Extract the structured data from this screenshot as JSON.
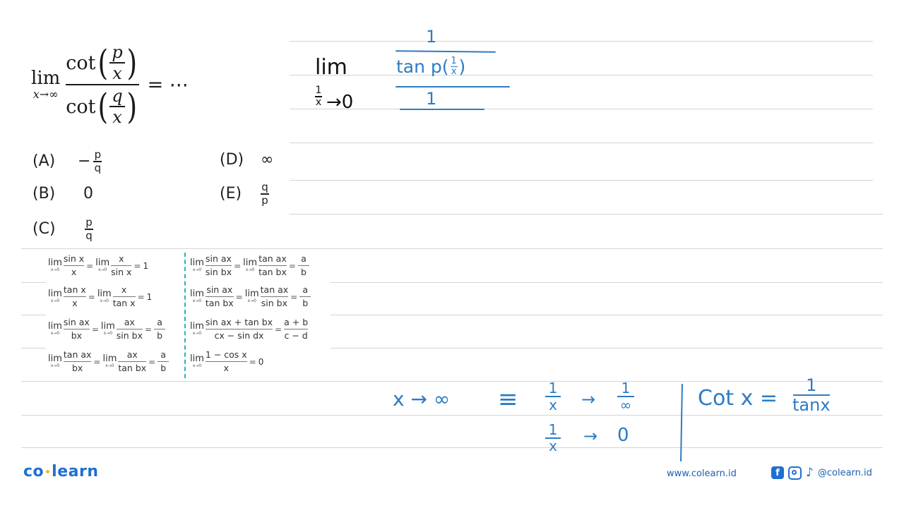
{
  "problem": {
    "lim_word": "lim",
    "lim_sub": "x→∞",
    "num_func": "cot",
    "num_top": "p",
    "num_bottom": "x",
    "den_func": "cot",
    "den_top": "q",
    "den_bottom": "x",
    "tail": "= ⋯"
  },
  "options": [
    {
      "label": "(A)",
      "prefix": "−",
      "num": "p",
      "den": "q"
    },
    {
      "label": "(B)",
      "value": "0"
    },
    {
      "label": "(C)",
      "num": "p",
      "den": "q"
    },
    {
      "label": "(D)",
      "value": "∞"
    },
    {
      "label": "(E)",
      "num": "q",
      "den": "p"
    }
  ],
  "formulas": {
    "left": [
      {
        "lim": "lim",
        "sub": "x→0",
        "f1n": "sin x",
        "f1d": "x",
        "f2n": "x",
        "f2d": "sin x",
        "result": "1"
      },
      {
        "lim": "lim",
        "sub": "x→0",
        "f1n": "tan x",
        "f1d": "x",
        "f2n": "x",
        "f2d": "tan x",
        "result": "1"
      },
      {
        "lim": "lim",
        "sub": "x→0",
        "f1n": "sin ax",
        "f1d": "bx",
        "f2n": "ax",
        "f2d": "sin bx",
        "rn": "a",
        "rd": "b"
      },
      {
        "lim": "lim",
        "sub": "x→0",
        "f1n": "tan ax",
        "f1d": "bx",
        "f2n": "ax",
        "f2d": "tan bx",
        "rn": "a",
        "rd": "b"
      }
    ],
    "right": [
      {
        "lim": "lim",
        "sub": "x→0",
        "f1n": "sin ax",
        "f1d": "sin bx",
        "f2n": "tan ax",
        "f2d": "tan bx",
        "rn": "a",
        "rd": "b"
      },
      {
        "lim": "lim",
        "sub": "x→0",
        "f1n": "sin ax",
        "f1d": "tan bx",
        "f2n": "tan ax",
        "f2d": "sin bx",
        "rn": "a",
        "rd": "b"
      },
      {
        "lim": "lim",
        "sub": "x→0",
        "f1n": "sin ax + tan bx",
        "f1d": "cx − sin dx",
        "rn": "a + b",
        "rd": "c − d"
      },
      {
        "lim": "lim",
        "sub": "x→0",
        "f1n": "1 − cos x",
        "f1d": "x",
        "result": "0"
      }
    ],
    "eq": "="
  },
  "handwriting": {
    "lim_word": "lim",
    "lim_sub_num": "1",
    "lim_sub_den": "x",
    "lim_sub_tail": "→0",
    "top_one": "1",
    "tan_expr": "tan p(",
    "tan_inner_num": "1",
    "tan_inner_den": "x",
    "tan_close": ")",
    "bottom_one": "1",
    "x_to_inf": "x → ∞",
    "equiv": "≡",
    "one": "1",
    "x": "x",
    "arrow": "→",
    "inf": "∞",
    "zero": "0",
    "cot_lhs": "Cot x =",
    "cot_rhs_den": "tanx"
  },
  "footer": {
    "logo_left": "co",
    "logo_right": "learn",
    "website": "www.colearn.id",
    "fb": "f",
    "tiktok": "♪",
    "handle": "@colearn.id"
  },
  "colors": {
    "ink_blue": "#2e7bc4",
    "brand_blue": "#1f6fd1",
    "divider_teal": "#2bb3c0",
    "rule_gray": "#d4d4d4"
  }
}
